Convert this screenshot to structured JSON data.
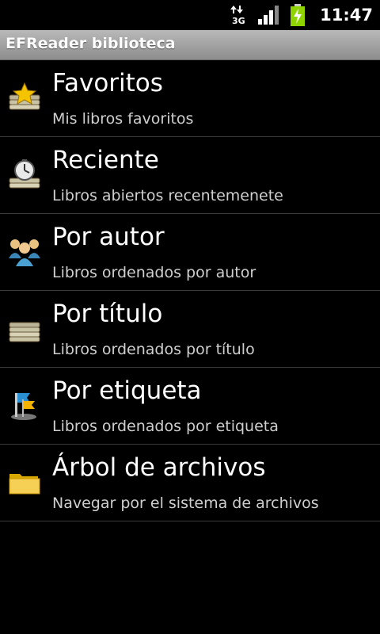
{
  "status_bar": {
    "network_type": "3G",
    "time": "11:47",
    "icons": [
      "data-transfer-icon",
      "signal-icon",
      "battery-charging-icon"
    ]
  },
  "app": {
    "title": "EFReader biblioteca"
  },
  "menu": {
    "items": [
      {
        "icon": "star-books-icon",
        "label": "Favoritos",
        "subtitle": "Mis libros favoritos"
      },
      {
        "icon": "clock-books-icon",
        "label": "Reciente",
        "subtitle": "Libros abiertos recentemenete"
      },
      {
        "icon": "people-icon",
        "label": "Por autor",
        "subtitle": "Libros ordenados por autor"
      },
      {
        "icon": "books-stack-icon",
        "label": "Por título",
        "subtitle": "Libros ordenados por título"
      },
      {
        "icon": "flag-icon",
        "label": "Por etiqueta",
        "subtitle": "Libros ordenados por etiqueta"
      },
      {
        "icon": "folder-icon",
        "label": "Árbol de archivos",
        "subtitle": "Navegar por el sistema de archivos"
      }
    ]
  }
}
